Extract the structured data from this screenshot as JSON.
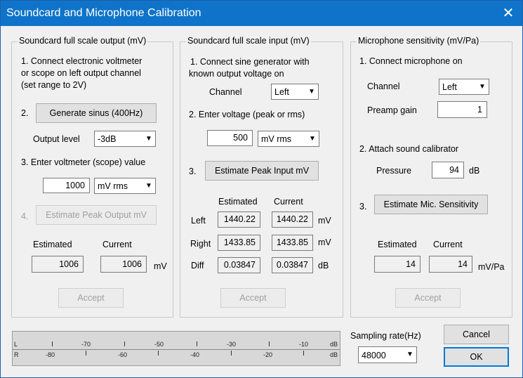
{
  "window": {
    "title": "Soundcard and Microphone Calibration",
    "close": "✕"
  },
  "output": {
    "title": "Soundcard full scale output (mV)",
    "step1": [
      "1. Connect electronic voltmeter",
      "or scope on left output channel",
      "(set range  to 2V)"
    ],
    "step2_num": "2.",
    "generate_btn": "Generate sinus (400Hz)",
    "output_level_label": "Output level",
    "output_level_value": "-3dB",
    "step3": "3. Enter voltmeter (scope) value",
    "voltmeter_value": "1000",
    "unit_value": "mV rms",
    "step4_num": "4.",
    "estimate_btn": "Estimate Peak Output mV",
    "estimated_label": "Estimated",
    "current_label": "Current",
    "estimated_value": "1006",
    "current_value": "1006",
    "unit": "mV",
    "accept": "Accept"
  },
  "input": {
    "title": "Soundcard full scale  input (mV)",
    "step1": [
      "1. Connect sine generator with",
      "known output voltage on"
    ],
    "channel_label": "Channel",
    "channel_value": "Left",
    "step2": "2. Enter voltage (peak or rms)",
    "voltage_value": "500",
    "unit_value": "mV rms",
    "step3_num": "3.",
    "estimate_btn": "Estimate Peak Input mV",
    "estimated_label": "Estimated",
    "current_label": "Current",
    "rows": [
      {
        "label": "Left",
        "estimated": "1440.22",
        "current": "1440.22",
        "unit": "mV"
      },
      {
        "label": "Right",
        "estimated": "1433.85",
        "current": "1433.85",
        "unit": "mV"
      },
      {
        "label": "Diff",
        "estimated": "0.03847",
        "current": "0.03847",
        "unit": "dB"
      }
    ],
    "accept": "Accept"
  },
  "mic": {
    "title": "Microphone sensitivity (mV/Pa)",
    "step1": "1. Connect microphone on",
    "channel_label": "Channel",
    "channel_value": "Left",
    "preamp_label": "Preamp  gain",
    "preamp_value": "1",
    "step2": "2. Attach sound calibrator",
    "pressure_label": "Pressure",
    "pressure_value": "94",
    "pressure_unit": "dB",
    "step3_num": "3.",
    "estimate_btn": "Estimate Mic. Sensitivity",
    "estimated_label": "Estimated",
    "current_label": "Current",
    "estimated_value": "14",
    "current_value": "14",
    "unit": "mV/Pa",
    "accept": "Accept"
  },
  "meter": {
    "left_label": "L",
    "right_label": "R",
    "top_ticks": [
      "-70",
      "-50",
      "-30",
      "-10",
      "dB"
    ],
    "bottom_ticks": [
      "-80",
      "-60",
      "-40",
      "-20",
      "dB"
    ]
  },
  "sampling": {
    "label": "Sampling rate(Hz)",
    "value": "48000"
  },
  "buttons": {
    "cancel": "Cancel",
    "ok": "OK"
  },
  "icons": {
    "dropdown": "▼"
  }
}
